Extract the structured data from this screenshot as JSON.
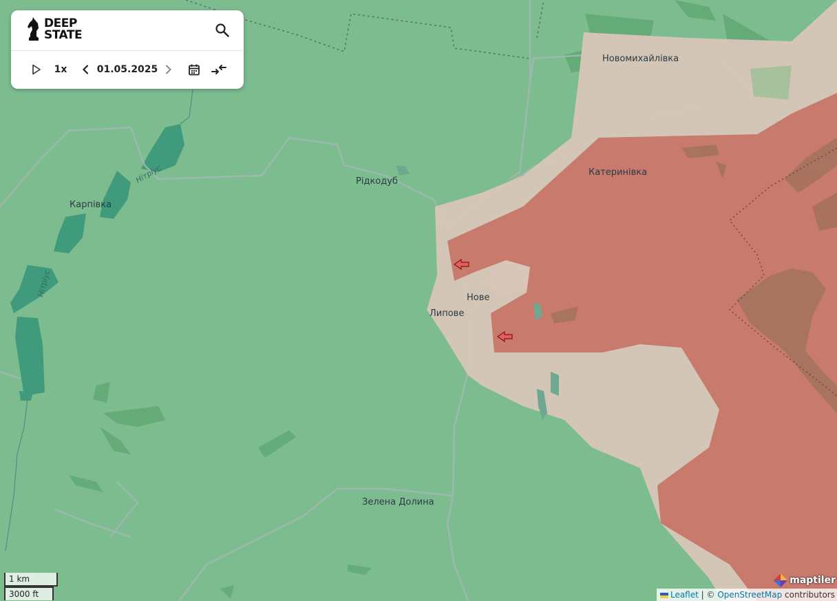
{
  "map": {
    "places": {
      "novomykhailivka": "Новомихайлівка",
      "katerynivka": "Катеринівка",
      "ridkodub": "Рідкодуб",
      "karpivka": "Карпівка",
      "nove": "Нове",
      "lypove": "Липове",
      "zelena_dolyna": "Зелена Долина"
    },
    "rivers": {
      "upper": "Нітріус",
      "lower": "Нітріус"
    },
    "colors": {
      "territory_green": "#7cbc8f",
      "contested_beige": "#d8c6b8",
      "occupied_red": "#c87a6c",
      "arrow_red": "#c0171c"
    }
  },
  "panel": {
    "logo_line1": "DEEP",
    "logo_line2": "STATE",
    "search_icon": "search-icon",
    "play_icon": "play-icon",
    "speed": "1x",
    "prev_icon": "chevron-left-icon",
    "date": "01.05.2025",
    "next_icon": "chevron-right-icon",
    "calendar_icon": "calendar-icon",
    "compare_icon": "compare-arrows-icon"
  },
  "scale": {
    "metric": "1 km",
    "imperial": "3000 ft"
  },
  "attribution": {
    "leaflet": "Leaflet",
    "separator": "| ©",
    "osm": "OpenStreetMap",
    "contributors": "contributors",
    "maptiler": "maptiler"
  }
}
